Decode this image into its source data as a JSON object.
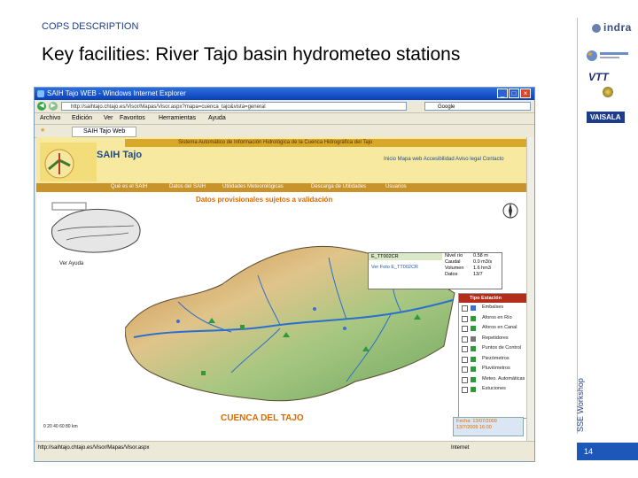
{
  "slide": {
    "section_label": "COPS DESCRIPTION",
    "title": "Key facilities: River Tajo basin hydrometeo stations",
    "side_text": "SSE Workshop",
    "page_number": "14",
    "logos": {
      "indra": "indra",
      "vtt": "VTT",
      "vaisala": "VAISALA"
    }
  },
  "browser": {
    "window_title": "SAIH Tajo WEB - Windows Internet Explorer",
    "url": "http://saihtajo.chtajo.es/Visor/Mapas/Visor.aspx?mapa=cuenca_tajo&vista=general",
    "search_text": "Google",
    "menu": [
      "Archivo",
      "Edición",
      "Ver",
      "Favoritos",
      "Herramientas",
      "Ayuda"
    ],
    "tab": "SAIH Tajo Web",
    "status_url": "http://saihtajo.chtajo.es/Visor/Mapas/Visor.aspx",
    "status_zone": "Internet"
  },
  "saih": {
    "top_bar": "Sistema Automático de Información Hidrológica de la Cuenca Hidrográfica del Tajo",
    "title": "SAIH Tajo",
    "links": "Inicio  Mapa web  Accesibilidad  Aviso legal  Contacto",
    "nav": [
      "Qué es el SAIH",
      "Datos del SAIH",
      "Utilidades Meteorológicas",
      "Descarga de Utilidades",
      "Usuarios"
    ],
    "notice": "Datos provisionales sujetos a validación",
    "ver_ayuda": "Ver Ayuda",
    "map_label": "CUENCA DEL TAJO",
    "scale": "0   20   40   60   80 km"
  },
  "legend": {
    "title": "Tipo Estación",
    "items": [
      {
        "label": "Embalses",
        "color": "#3b6fd8"
      },
      {
        "label": "Aforos en Río",
        "color": "#2f9a3a"
      },
      {
        "label": "Aforos en Canal",
        "color": "#2f9a3a"
      },
      {
        "label": "Repetidores",
        "color": "#777777"
      },
      {
        "label": "Puntos de Control",
        "color": "#2f9a3a"
      },
      {
        "label": "Piezómetros",
        "color": "#2f9a3a"
      },
      {
        "label": "Pluviómetros",
        "color": "#2f9a3a"
      },
      {
        "label": "Meteo. Automáticas",
        "color": "#2f9a3a"
      },
      {
        "label": "Estuciones",
        "color": "#2f9a3a"
      }
    ]
  },
  "popup": {
    "header": "E_TT002CR",
    "label": "Ver Foto E_TT002CR",
    "col1": [
      "Nivel río",
      "Caudal",
      "Volumen",
      "Datos"
    ],
    "col2": [
      "0.58 m",
      "0.0 m3/s",
      "1.6 hm3",
      "13/7"
    ]
  },
  "datebox": {
    "line1": "Fecha: 13/07/2009",
    "line2": "13/7/2009  16:00"
  }
}
